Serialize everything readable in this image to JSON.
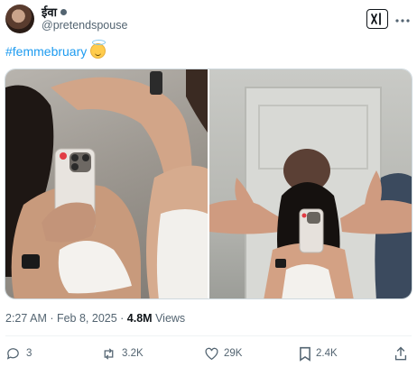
{
  "author": {
    "display_name": "ईवा",
    "handle": "@pretendspouse"
  },
  "tweet": {
    "text": "#femmebruary",
    "emoji_icon": "smiling-face-with-halo-icon"
  },
  "media": {
    "count": 2,
    "images": [
      {
        "name": "mirror-selfie-left"
      },
      {
        "name": "mirror-selfie-right"
      }
    ]
  },
  "meta": {
    "timestamp": "2:27 AM · Feb 8, 2025 · ",
    "views_count": "4.8M",
    "views_label": " Views"
  },
  "actions": {
    "replies": "3",
    "reposts": "3.2K",
    "likes": "29K",
    "bookmarks": "2.4K"
  },
  "colors": {
    "accent": "#1d9bf0",
    "secondary_text": "#536471",
    "divider": "#eff3f4"
  }
}
